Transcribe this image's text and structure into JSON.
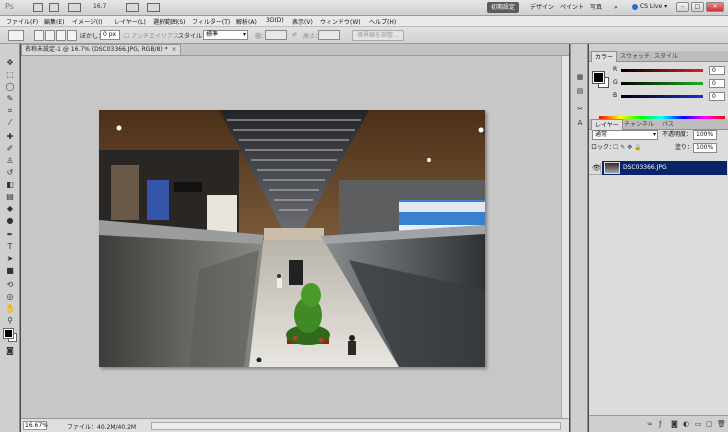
{
  "app": {
    "logo": "Ps",
    "zoom": "16.7",
    "workspaces": [
      "初期設定",
      "デザイン",
      "ペイント",
      "写真"
    ],
    "more": "»",
    "cslive": "CS Live ▾"
  },
  "menu": [
    "ファイル(F)",
    "編集(E)",
    "イメージ(I)",
    "レイヤー(L)",
    "選択範囲(S)",
    "フィルター(T)",
    "解析(A)",
    "3D(D)",
    "表示(V)",
    "ウィンドウ(W)",
    "ヘルプ(H)"
  ],
  "options": {
    "feather_label": "ぼかし：",
    "feather_value": "0 px",
    "antialias_label": "アンチエイリアス",
    "style_label": "スタイル：",
    "style_value": "標準",
    "width_label": "幅：",
    "height_label": "高さ：",
    "refine_button": "境界線を調整..."
  },
  "document": {
    "tab_title": "名称未設定-1 @ 16.7% (DSC03366.JPG, RGB/8) *",
    "tab_close": "×"
  },
  "status": {
    "zoom": "16.67%",
    "file_info": "ファイル：40.2M/40.2M"
  },
  "color_panel": {
    "tabs": [
      "カラー",
      "スウォッチ",
      "スタイル"
    ],
    "channels": [
      {
        "name": "R",
        "value": "0",
        "color": "#e02020"
      },
      {
        "name": "G",
        "value": "0",
        "color": "#20b020"
      },
      {
        "name": "B",
        "value": "0",
        "color": "#2030d0"
      }
    ]
  },
  "layers_panel": {
    "tabs": [
      "レイヤー",
      "チャンネル",
      "パス"
    ],
    "blend_mode": "通常",
    "opacity_label": "不透明度：",
    "opacity_value": "100%",
    "lock_label": "ロック：",
    "fill_label": "塗り：",
    "fill_value": "100%",
    "layer_name": "DSC03366.JPG"
  },
  "colors": {
    "selection": "#0a246a",
    "active_workspace": "#5b5b5b"
  }
}
